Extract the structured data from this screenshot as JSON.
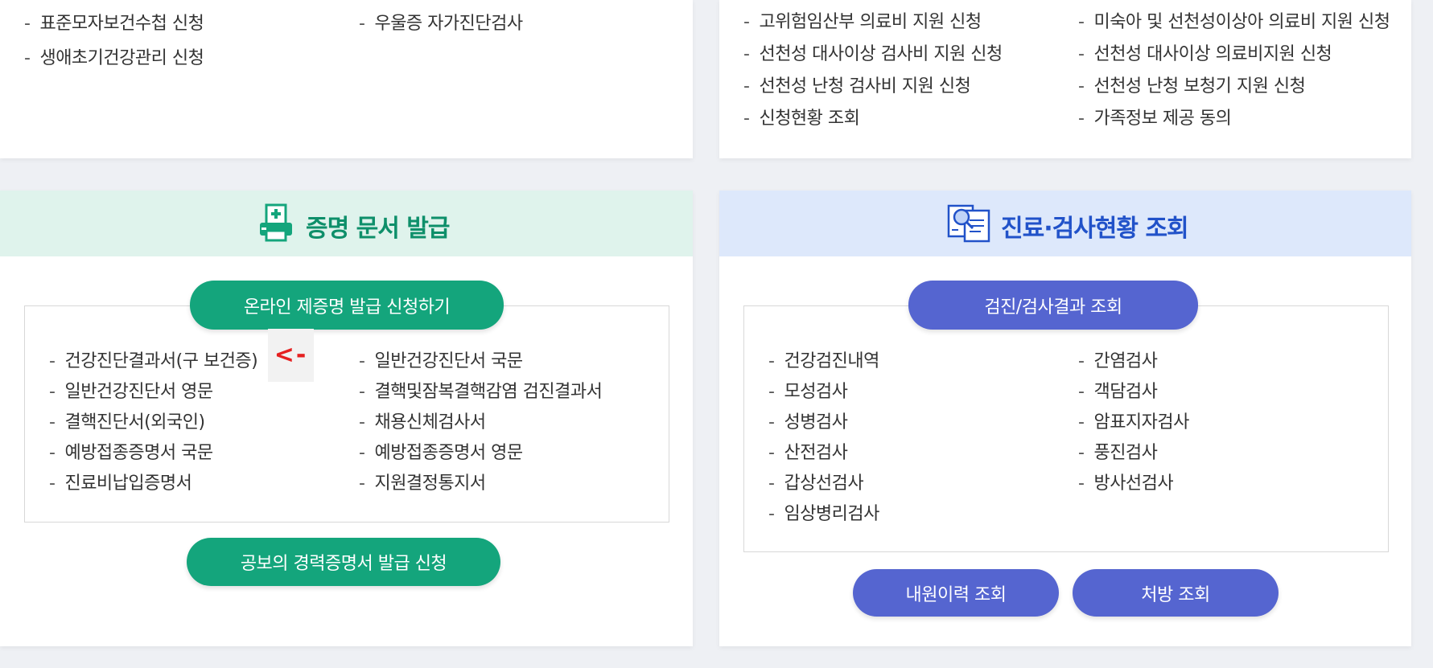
{
  "top_left": {
    "items": [
      "표준모자보건수첩 신청",
      "우울증 자가진단검사",
      "생애초기건강관리 신청"
    ]
  },
  "top_right": {
    "items": [
      "고위험임산부 의료비 지원 신청",
      "미숙아 및 선천성이상아 의료비 지원 신청",
      "선천성 대사이상 검사비 지원 신청",
      "선천성 대사이상 의료비지원 신청",
      "선천성 난청 검사비 지원 신청",
      "선천성 난청 보청기 지원 신청",
      "신청현황 조회",
      "가족정보 제공 동의"
    ]
  },
  "certificates": {
    "title": "증명 문서 발급",
    "icon": "printer-icon",
    "apply_button": "온라인 제증명 발급 신청하기",
    "items": [
      "건강진단결과서(구 보건증)",
      "일반건강진단서 국문",
      "일반건강진단서 영문",
      "결핵및잠복결핵감염 검진결과서",
      "결핵진단서(외국인)",
      "채용신체검사서",
      "예방접종증명서 국문",
      "예방접종증명서 영문",
      "진료비납입증명서",
      "지원결정통지서"
    ],
    "marker": "<-",
    "bottom_button": "공보의 경력증명서 발급 신청",
    "accent": "#14a57c"
  },
  "exams": {
    "title": "진료·검사현황 조회",
    "icon": "document-search-icon",
    "results_button": "검진/검사결과 조회",
    "items": [
      "건강검진내역",
      "간염검사",
      "모성검사",
      "객담검사",
      "성병검사",
      "암표지자검사",
      "산전검사",
      "풍진검사",
      "갑상선검사",
      "방사선검사",
      "임상병리검사"
    ],
    "history_button": "내원이력 조회",
    "prescription_button": "처방 조회",
    "accent": "#5565d0"
  }
}
